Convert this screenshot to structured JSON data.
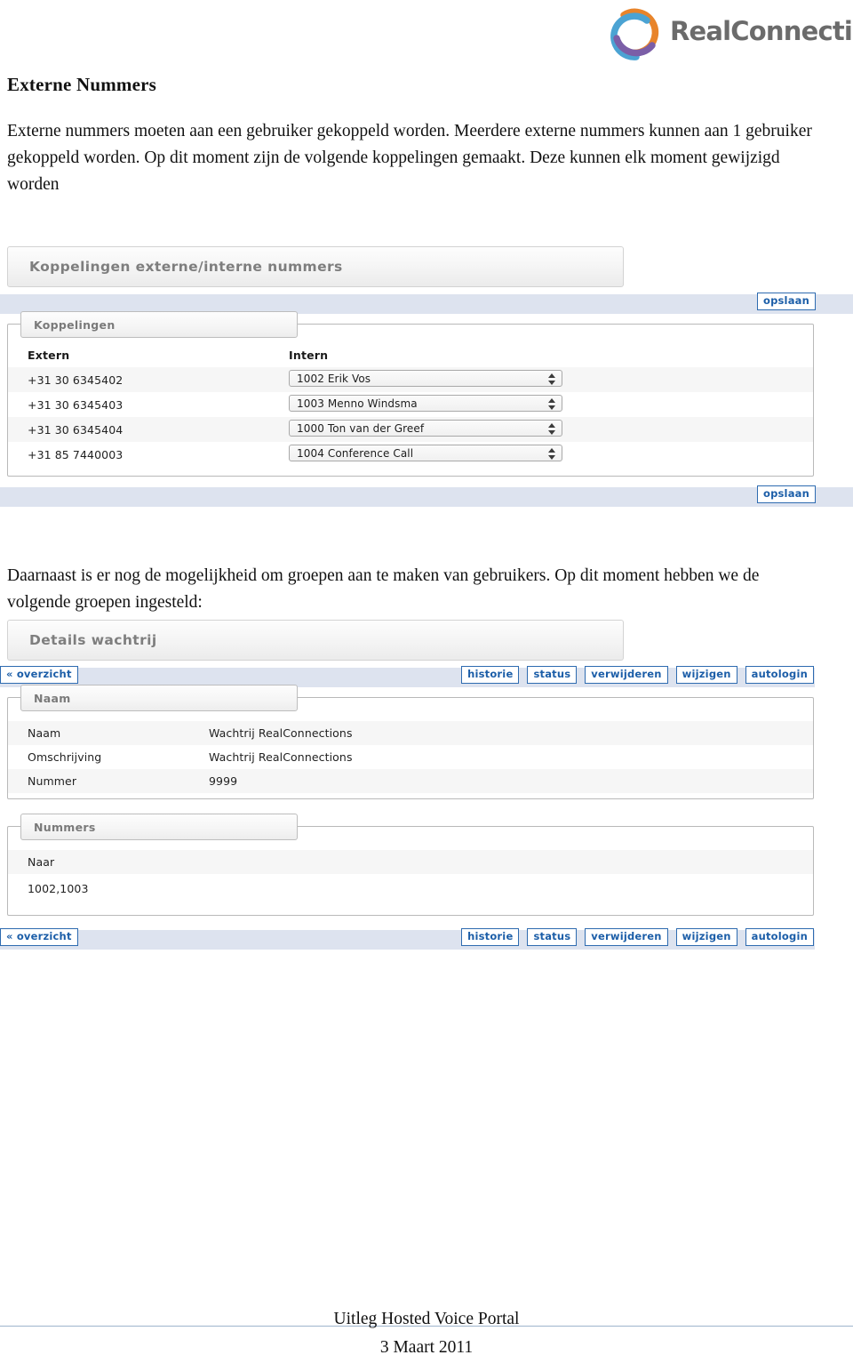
{
  "logo": {
    "name": "RealConnections",
    "colors": {
      "orange": "#e8842a",
      "blue": "#4ba3d3",
      "purple": "#7b5ea7",
      "text": "#6b6b6b"
    }
  },
  "document": {
    "heading": "Externe Nummers",
    "paragraph_top": "Externe nummers moeten aan een gebruiker gekoppeld worden. Meerdere externe nummers kunnen aan 1 gebruiker gekoppeld worden. Op dit moment zijn de volgende koppelingen gemaakt. Deze kunnen elk moment gewijzigd worden",
    "paragraph_middle": "Daarnaast is er nog de mogelijkheid om groepen aan te maken van gebruikers. Op dit moment hebben we de volgende groepen ingesteld:"
  },
  "screenshot_koppelingen": {
    "panel_title": "Koppelingen externe/interne nummers",
    "save_label": "opslaan",
    "fieldset_legend": "Koppelingen",
    "columns": [
      "Extern",
      "Intern"
    ],
    "rows": [
      {
        "extern": "+31 30 6345402",
        "intern": "1002 Erik Vos"
      },
      {
        "extern": "+31 30 6345403",
        "intern": "1003 Menno Windsma"
      },
      {
        "extern": "+31 30 6345404",
        "intern": "1000 Ton van der Greef"
      },
      {
        "extern": "+31 85 7440003",
        "intern": "1004 Conference Call"
      }
    ]
  },
  "screenshot_wachtrij": {
    "panel_title": "Details wachtrij",
    "back_label": "« overzicht",
    "toolbar": [
      "historie",
      "status",
      "verwijderen",
      "wijzigen",
      "autologin"
    ],
    "naam_legend": "Naam",
    "naam_rows": [
      {
        "label": "Naam",
        "value": "Wachtrij RealConnections"
      },
      {
        "label": "Omschrijving",
        "value": "Wachtrij RealConnections"
      },
      {
        "label": "Nummer",
        "value": "9999"
      }
    ],
    "nummers_legend": "Nummers",
    "nummers_header": "Naar",
    "nummers_value": "1002,1003"
  },
  "footer": {
    "line1": "Uitleg Hosted Voice Portal",
    "line2": "3 Maart 2011"
  }
}
